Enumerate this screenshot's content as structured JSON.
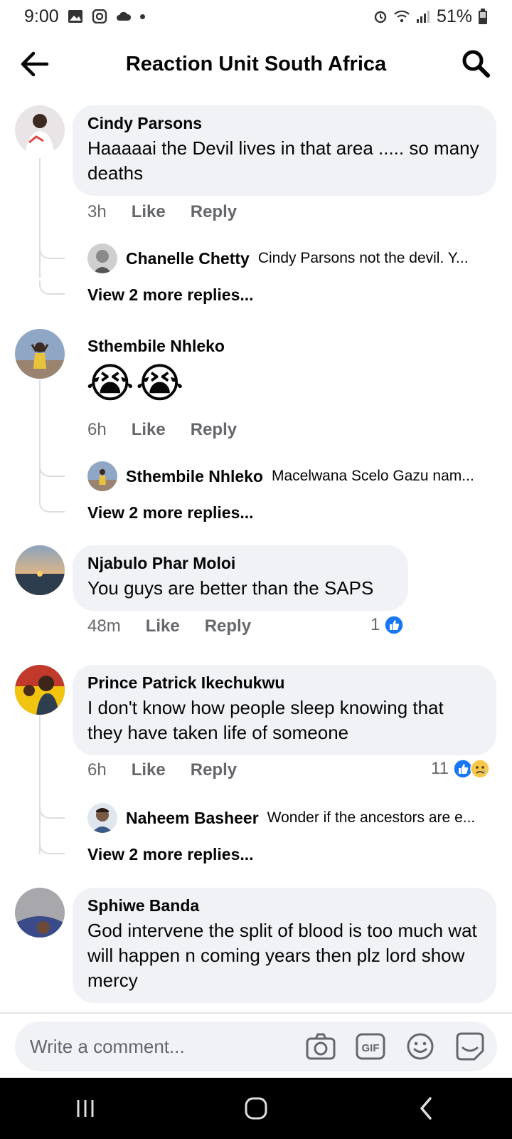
{
  "status": {
    "time": "9:00",
    "battery": "51%"
  },
  "header": {
    "title": "Reaction Unit South Africa"
  },
  "comments": [
    {
      "name": "Cindy Parsons",
      "text": "Haaaaai the Devil lives in that area ..... so many deaths",
      "time": "3h",
      "like": "Like",
      "reply": "Reply",
      "reply_preview": {
        "name": "Chanelle Chetty",
        "text": "Cindy Parsons not the devil. Y..."
      },
      "more": "View 2 more replies..."
    },
    {
      "name": "Sthembile Nhleko",
      "text": "😭😭",
      "time": "6h",
      "like": "Like",
      "reply": "Reply",
      "reply_preview": {
        "name": "Sthembile Nhleko",
        "text": "Macelwana Scelo Gazu nam..."
      },
      "more": "View 2 more replies..."
    },
    {
      "name": "Njabulo Phar Moloi",
      "text": "You guys are better than the SAPS",
      "time": "48m",
      "like": "Like",
      "reply": "Reply",
      "reaction_count": "1"
    },
    {
      "name": "Prince Patrick Ikechukwu",
      "text": "I don't know how people sleep knowing that they have taken life of someone",
      "time": "6h",
      "like": "Like",
      "reply": "Reply",
      "reaction_count": "11",
      "reply_preview": {
        "name": "Naheem Basheer",
        "text": "Wonder if the ancestors are e..."
      },
      "more": "View 2 more replies..."
    },
    {
      "name": "Sphiwe Banda",
      "text": "God intervene the split of blood is too much wat will happen n coming years then plz lord show mercy"
    }
  ],
  "composer": {
    "placeholder": "Write a comment..."
  },
  "icons": {
    "back": "arrow-left-icon",
    "search": "search-icon",
    "camera": "camera-icon",
    "gif": "gif-icon",
    "emoji": "emoji-icon",
    "sticker": "sticker-icon"
  },
  "colors": {
    "like_blue": "#1877f2",
    "bubble": "#f0f2f5",
    "muted": "#65676b"
  }
}
